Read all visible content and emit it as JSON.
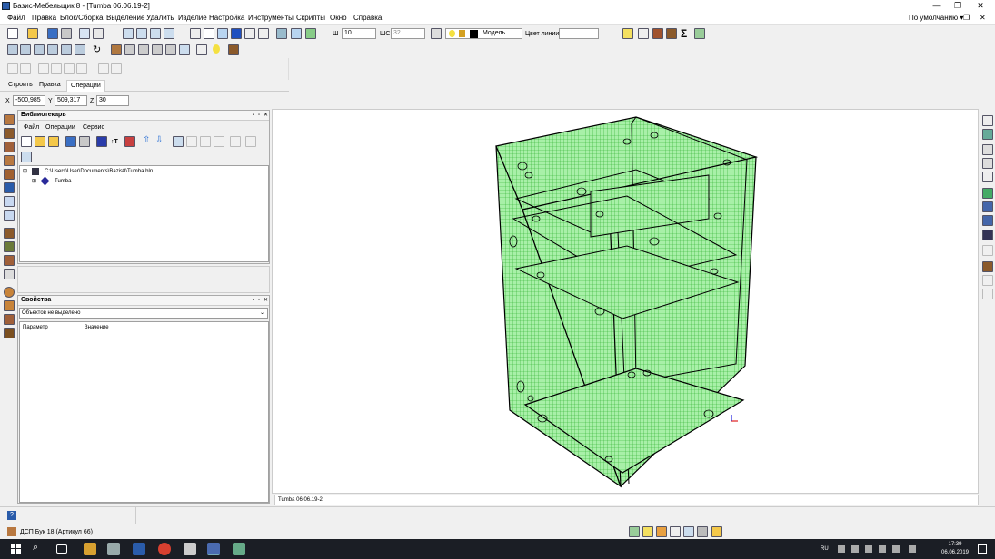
{
  "window": {
    "title": "Базис-Мебельщик 8 - [Tumba 06.06.19-2]",
    "minimize": "—",
    "restore": "❐",
    "close": "✕",
    "doc_restore": "❐",
    "doc_close": "✕"
  },
  "menu": {
    "items": [
      "Файл",
      "Правка",
      "Блок/Сборка",
      "Выделение",
      "Удалить",
      "Изделие",
      "Настройка",
      "Инструменты",
      "Скрипты",
      "Окно",
      "Справка"
    ],
    "right_dropdown": "По умолчанию ▾"
  },
  "toolbar": {
    "w_label": "Ш",
    "w_value": "10",
    "shs_label": "ШС",
    "shs_value": "32",
    "layer_value": "Модель",
    "line_color_label": "Цвет линии"
  },
  "tabs": {
    "build": "Строить",
    "edit": "Правка",
    "operations": "Операции"
  },
  "coords": {
    "x_label": "X",
    "x_value": "-500,985",
    "y_label": "Y",
    "y_value": "509,317",
    "z_label": "Z",
    "z_value": "30"
  },
  "librarian": {
    "title": "Библиотекарь",
    "menu": [
      "Файл",
      "Операции",
      "Сервис"
    ],
    "tree_path": "C:\\Users\\User\\Documents\\Bazis8\\Tumba.bln",
    "tree_child": "Tumba",
    "pin": "▪",
    "restore": "▫",
    "close": "✕",
    "expand": "⊟",
    "expand_child": "⊞"
  },
  "properties": {
    "title": "Свойства",
    "selection": "Объектов не выделено",
    "col_param": "Параметр",
    "col_value": "Значение",
    "pin": "▪",
    "restore": "▫",
    "close": "✕",
    "dropdown": "⌄"
  },
  "viewport": {
    "doc_tab": "Tumba 06.06.19-2"
  },
  "statusbar": {
    "material": "ДСП Бук 18 (Артикул 66)",
    "help": "?"
  },
  "taskbar": {
    "lang": "RU",
    "time": "17:39",
    "date": "06.06.2019"
  },
  "colors": {
    "cabinet_fill": "#a8f0a8",
    "cabinet_grid": "#18a818",
    "cabinet_edge": "#000000",
    "taskbar": "#1b1e25"
  }
}
